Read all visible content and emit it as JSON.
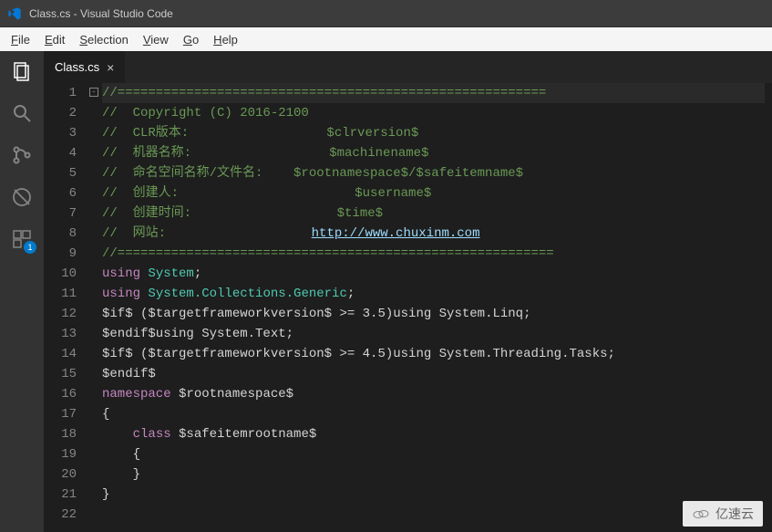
{
  "titlebar": {
    "title": "Class.cs - Visual Studio Code"
  },
  "menubar": [
    {
      "label": "File",
      "hotkey": "F"
    },
    {
      "label": "Edit",
      "hotkey": "E"
    },
    {
      "label": "Selection",
      "hotkey": "S"
    },
    {
      "label": "View",
      "hotkey": "V"
    },
    {
      "label": "Go",
      "hotkey": "G"
    },
    {
      "label": "Help",
      "hotkey": "H"
    }
  ],
  "activitybar": {
    "items": [
      {
        "name": "explorer",
        "active": true
      },
      {
        "name": "search"
      },
      {
        "name": "scm"
      },
      {
        "name": "debug"
      },
      {
        "name": "extensions",
        "badge": "1"
      }
    ]
  },
  "tabs": [
    {
      "label": "Class.cs",
      "active": true
    }
  ],
  "current_line": 1,
  "code_lines": [
    {
      "n": 1,
      "type": "comment",
      "text": "//========================================================"
    },
    {
      "n": 2,
      "type": "comment",
      "text": "//  Copyright (C) 2016-2100"
    },
    {
      "n": 3,
      "type": "comment",
      "text": "//  CLR版本:                  $clrversion$"
    },
    {
      "n": 4,
      "type": "comment",
      "text": "//  机器名称:                  $machinename$"
    },
    {
      "n": 5,
      "type": "comment",
      "text": "//  命名空间名称/文件名:    $rootnamespace$/$safeitemname$"
    },
    {
      "n": 6,
      "type": "comment",
      "text": "//  创建人:                       $username$"
    },
    {
      "n": 7,
      "type": "comment",
      "text": "//  创建时间:                   $time$"
    },
    {
      "n": 8,
      "type": "comment-url",
      "prefix": "//  网站:                   ",
      "url": "http://www.chuxinm.com"
    },
    {
      "n": 9,
      "type": "comment",
      "text": "//========================================================="
    },
    {
      "n": 10,
      "type": "using",
      "text": "using System;"
    },
    {
      "n": 11,
      "type": "using",
      "text": "using System.Collections.Generic;"
    },
    {
      "n": 12,
      "type": "plain",
      "text": "$if$ ($targetframeworkversion$ >= 3.5)using System.Linq;"
    },
    {
      "n": 13,
      "type": "plain",
      "text": "$endif$using System.Text;"
    },
    {
      "n": 14,
      "type": "plain",
      "text": "$if$ ($targetframeworkversion$ >= 4.5)using System.Threading.Tasks;"
    },
    {
      "n": 15,
      "type": "plain",
      "text": "$endif$"
    },
    {
      "n": 16,
      "type": "ns",
      "text": "namespace $rootnamespace$"
    },
    {
      "n": 17,
      "type": "plain",
      "text": "{",
      "fold": true
    },
    {
      "n": 18,
      "type": "class",
      "text": "    class $safeitemrootname$"
    },
    {
      "n": 19,
      "type": "plain",
      "text": "    {"
    },
    {
      "n": 20,
      "type": "plain",
      "text": "    }"
    },
    {
      "n": 21,
      "type": "plain",
      "text": "}"
    },
    {
      "n": 22,
      "type": "plain",
      "text": ""
    }
  ],
  "watermark": "亿速云"
}
